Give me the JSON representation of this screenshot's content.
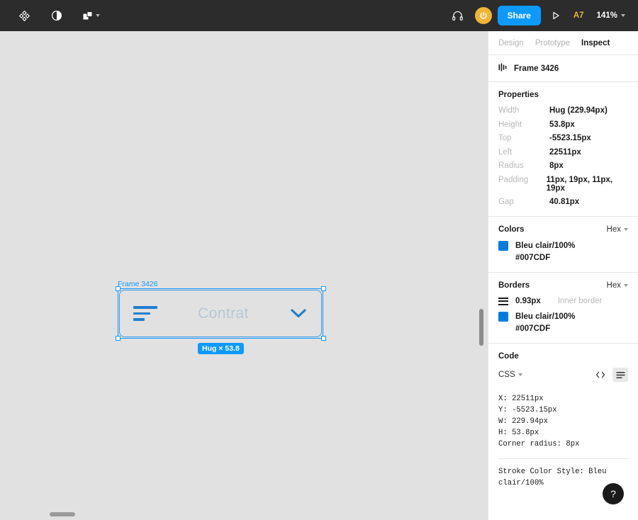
{
  "toolbar": {
    "menu_icon": "figma-logo-icon",
    "contrast_icon": "contrast-icon",
    "shapes_icon": "shape-tool-icon",
    "headphones_icon": "headphones-icon",
    "avatar_icon": "user-avatar",
    "share_label": "Share",
    "present_icon": "present-play-icon",
    "user_badge": "A7",
    "zoom_level": "141%",
    "accent_color": "#0d99ff",
    "avatar_color": "#f0b537",
    "badge_color": "#e8b931",
    "bar_color": "#2c2c2c"
  },
  "canvas": {
    "background": "#e1e1e1",
    "frame_label": "Frame 3426",
    "size_badge": "Hug × 53.8",
    "selection_color": "#0d99ff",
    "node": {
      "sort_icon": "sort-lines-icon",
      "text": "Contrat",
      "text_color": "#b9c6d6",
      "chevron_icon": "chevron-down-icon",
      "chevron_color": "#1f7fd0",
      "border_color": "#3d9ae8"
    }
  },
  "panel": {
    "tabs": [
      {
        "label": "Design",
        "active": false
      },
      {
        "label": "Prototype",
        "active": false
      },
      {
        "label": "Inspect",
        "active": true
      }
    ],
    "node": {
      "icon": "frame-icon",
      "name": "Frame 3426"
    },
    "properties": {
      "title": "Properties",
      "rows": [
        {
          "key": "Width",
          "value": "Hug (229.94px)"
        },
        {
          "key": "Height",
          "value": "53.8px"
        },
        {
          "key": "Top",
          "value": "-5523.15px"
        },
        {
          "key": "Left",
          "value": "22511px"
        },
        {
          "key": "Radius",
          "value": "8px"
        },
        {
          "key": "Padding",
          "value": "11px, 19px, 11px, 19px"
        },
        {
          "key": "Gap",
          "value": "40.81px"
        }
      ]
    },
    "colors": {
      "title": "Colors",
      "format": "Hex",
      "swatch_color": "#007CDF",
      "style_name": "Bleu clair/100%",
      "hex": "#007CDF"
    },
    "borders": {
      "title": "Borders",
      "format": "Hex",
      "weight_icon": "stroke-weight-icon",
      "weight": "0.93px",
      "position": "Inner border",
      "swatch_color": "#007CDF",
      "style_name": "Bleu clair/100%",
      "hex": "#007CDF"
    },
    "code": {
      "title": "Code",
      "language": "CSS",
      "code_icon": "code-brackets-icon",
      "list_icon": "list-view-icon",
      "lines": "X: 22511px\nY: -5523.15px\nW: 229.94px\nH: 53.8px\nCorner radius: 8px",
      "stroke_line": "Stroke Color Style: Bleu clair/100%"
    }
  },
  "help": {
    "label": "?"
  }
}
